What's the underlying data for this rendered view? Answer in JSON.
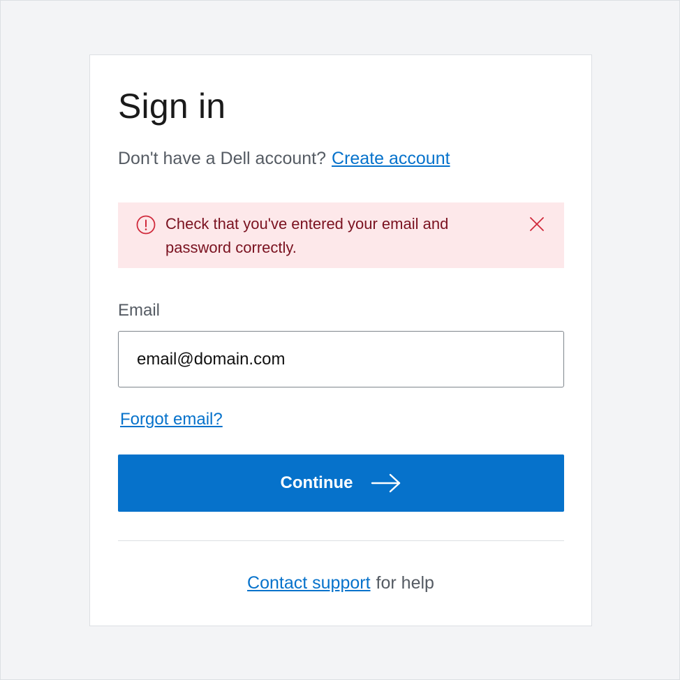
{
  "page": {
    "title": "Sign in",
    "no_account_text": "Don't have a Dell account?",
    "create_account_link": "Create account"
  },
  "alert": {
    "message": "Check that you've entered your email and password correctly.",
    "icon": "error-circle-icon",
    "close_icon": "close-icon"
  },
  "form": {
    "email_label": "Email",
    "email_value": "email@domain.com",
    "forgot_email_link": "Forgot email?",
    "continue_label": "Continue",
    "continue_icon": "arrow-right-icon"
  },
  "footer": {
    "contact_link": "Contact support",
    "suffix_text": "for help"
  },
  "colors": {
    "accent": "#0672cb",
    "alert_bg": "#fde8ea",
    "alert_text": "#7a1220",
    "alert_icon": "#d0293b",
    "page_bg": "#f3f4f6"
  }
}
